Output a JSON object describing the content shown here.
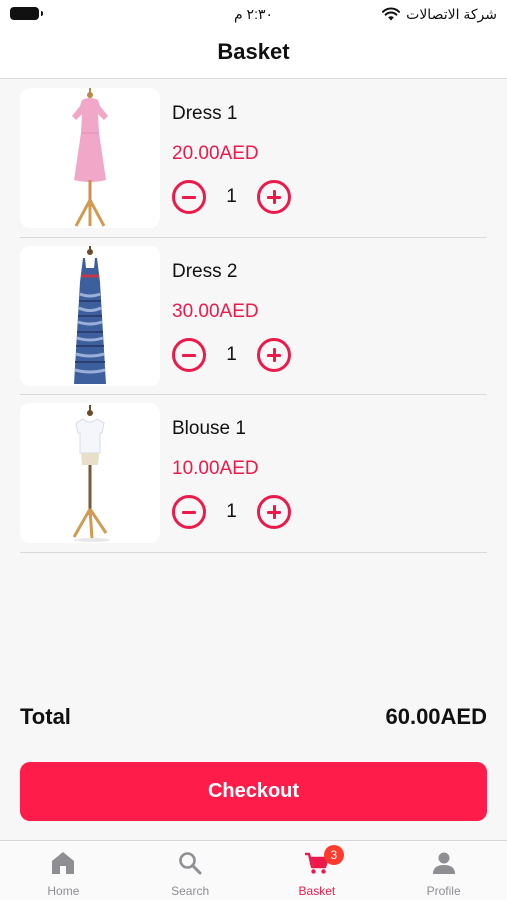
{
  "status_bar": {
    "time": "٢:٣٠ م",
    "carrier": "شركة الاتصالات"
  },
  "header": {
    "title": "Basket"
  },
  "basket": {
    "items": [
      {
        "name": "Dress 1",
        "price": "20.00AED",
        "quantity": "1"
      },
      {
        "name": "Dress 2",
        "price": "30.00AED",
        "quantity": "1"
      },
      {
        "name": "Blouse 1",
        "price": "10.00AED",
        "quantity": "1"
      }
    ]
  },
  "summary": {
    "total_label": "Total",
    "total_value": "60.00AED"
  },
  "checkout_label": "Checkout",
  "tab_bar": {
    "tabs": [
      {
        "label": "Home",
        "icon": "home-icon"
      },
      {
        "label": "Search",
        "icon": "search-icon"
      },
      {
        "label": "Basket",
        "icon": "cart-icon",
        "badge": "3",
        "active": true
      },
      {
        "label": "Profile",
        "icon": "profile-icon"
      }
    ]
  },
  "colors": {
    "accent": "#ec1a4b",
    "checkout": "#fe1c4b",
    "badge": "#ff3b30",
    "inactive_tab": "#8e8e93"
  }
}
